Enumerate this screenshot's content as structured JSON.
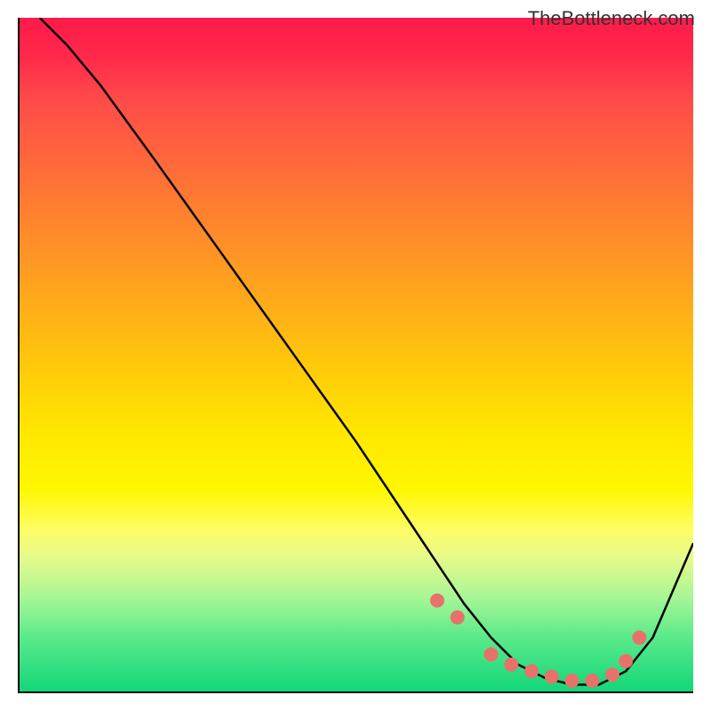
{
  "watermark": "TheBottleneck.com",
  "chart_data": {
    "type": "line",
    "title": "",
    "xlabel": "",
    "ylabel": "",
    "xlim": [
      0,
      100
    ],
    "ylim": [
      0,
      100
    ],
    "series": [
      {
        "name": "curve",
        "x": [
          3,
          7,
          12,
          20,
          30,
          40,
          50,
          58,
          62,
          66,
          70,
          74,
          78,
          82,
          86,
          90,
          94,
          100
        ],
        "y": [
          100,
          96,
          90,
          79,
          65,
          51,
          37,
          25,
          19,
          13,
          8,
          4,
          2,
          1,
          1,
          3,
          8,
          22
        ]
      }
    ],
    "markers": {
      "name": "dots",
      "x": [
        62,
        65,
        70,
        73,
        76,
        79,
        82,
        85,
        88,
        90,
        92
      ],
      "y": [
        13.5,
        11,
        5.5,
        4,
        3,
        2.2,
        1.6,
        1.6,
        2.5,
        4.5,
        8
      ]
    },
    "colors": {
      "gradient_top": "#ff1a4a",
      "gradient_mid": "#ffe800",
      "gradient_bottom": "#12d679",
      "marker": "#e8716b",
      "line": "#000000"
    }
  }
}
